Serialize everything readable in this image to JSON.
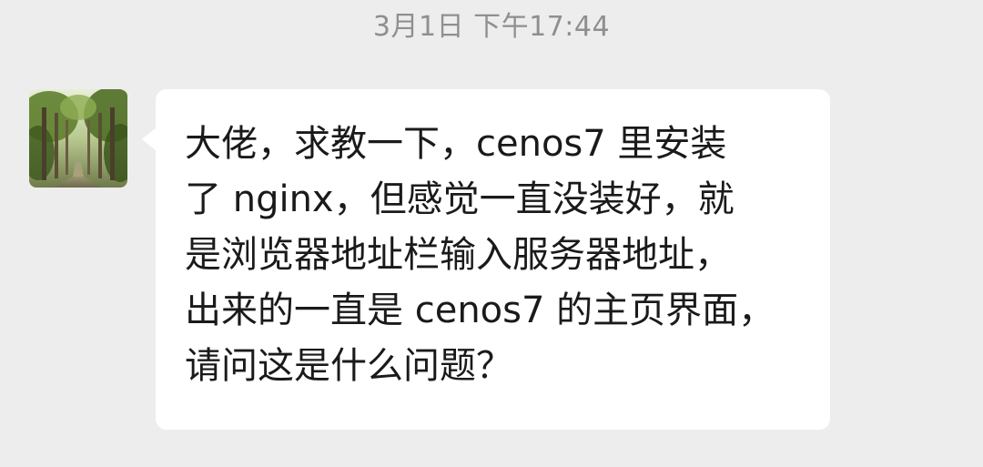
{
  "chat": {
    "timestamp": "3月1日 下午17:44",
    "message": {
      "sender_avatar": "avatar-forest-path-photo",
      "text": "大佬，求教一下，cenos7 里安装\n了 nginx，但感觉一直没装好，就\n是浏览器地址栏输入服务器地址，\n出来的一直是 cenos7 的主页界面，\n请问这是什么问题？"
    }
  },
  "colors": {
    "background": "#ededed",
    "bubble": "#ffffff",
    "text": "#1a1a1a",
    "timestamp": "#8f8f8f"
  }
}
